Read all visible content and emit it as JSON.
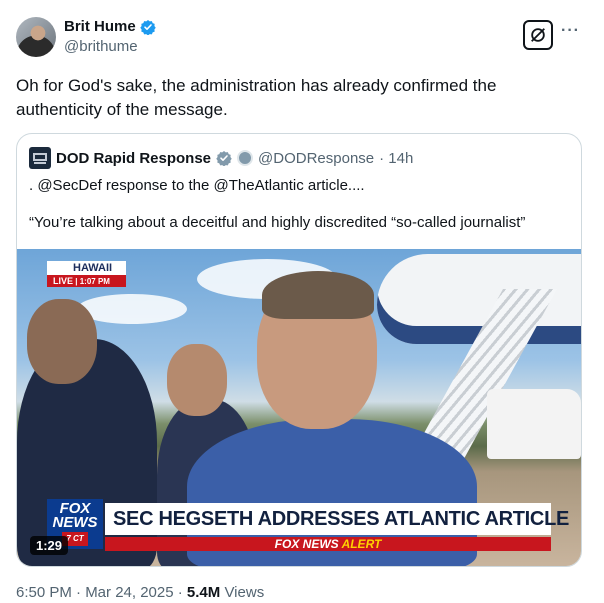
{
  "author": {
    "display_name": "Brit Hume",
    "handle": "@brithume"
  },
  "tweet": {
    "text": "Oh for God's sake, the administration has already confirmed the authenticity of the message."
  },
  "quoted": {
    "display_name": "DOD Rapid Response",
    "handle": "@DODResponse",
    "time": "· 14h",
    "line1": ". @SecDef response to the @TheAtlantic article....",
    "line2": "“You’re talking about a deceitful and highly discredited “so-called journalist”"
  },
  "video": {
    "live_location": "HAWAII",
    "live_label": "LIVE",
    "live_time": "1:07 PM",
    "network_logo_line1": "FOX",
    "network_logo_line2": "NEWS",
    "network_logo_tz": "7 CT",
    "headline": "SEC HEGSETH ADDRESSES ATLANTIC ARTICLE",
    "alert_brand": "FOX NEWS",
    "alert_word": "ALERT",
    "duration": "1:29"
  },
  "meta": {
    "timestamp": "6:50 PM · Mar 24, 2025 · ",
    "views_count": "5.4M",
    "views_label": " Views"
  },
  "icons": {
    "verified": "verified-badge-icon",
    "grok": "grok-icon",
    "more": "more-icon",
    "gov_badge": "government-badge-icon"
  },
  "colors": {
    "verified_blue": "#1d9bf0",
    "fox_red": "#c8161e",
    "fox_blue": "#0b3b8f"
  }
}
